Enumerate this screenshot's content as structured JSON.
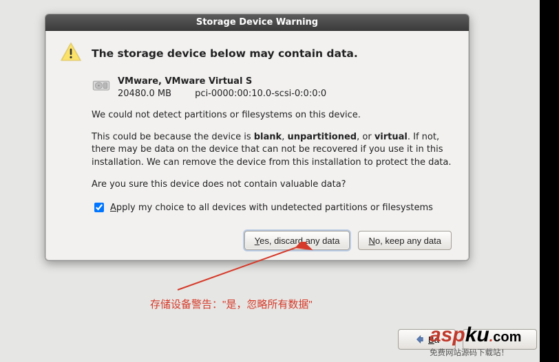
{
  "dialog": {
    "title": "Storage Device Warning",
    "heading": "The storage device below may contain data.",
    "device": {
      "name": "VMware, VMware Virtual S",
      "size": "20480.0 MB",
      "path": "pci-0000:00:10.0-scsi-0:0:0:0"
    },
    "para1": "We could not detect partitions or filesystems on this device.",
    "para2_prefix": "This could be because the device is ",
    "para2_blank": "blank",
    "para2_sep1": ", ",
    "para2_unpart": "unpartitioned",
    "para2_sep2": ", or ",
    "para2_virtual": "virtual",
    "para2_suffix": ". If not, there may be data on the device that can not be recovered if you use it in this installation. We can remove the device from this installation to protect the data.",
    "para3": "Are you sure this device does not contain valuable data?",
    "checkbox_mnemonic": "A",
    "checkbox_label_rest": "pply my choice to all devices with undetected partitions or filesystems",
    "checkbox_checked": true,
    "yes_btn_mnemonic": "Y",
    "yes_btn_rest": "es, discard any data",
    "no_btn_mnemonic": "N",
    "no_btn_rest": "o, keep any data"
  },
  "nav": {
    "back_mnemonic": "B",
    "back_rest": "a"
  },
  "annotation": {
    "text": "存储设备警告：\"是，忽略所有数据\""
  },
  "watermark": {
    "part1": "asp",
    "part2": "ku",
    "dot": ".",
    "tld": "com",
    "sub": "免费网站源码下载站！"
  },
  "colors": {
    "accent_red": "#d63a2a"
  }
}
